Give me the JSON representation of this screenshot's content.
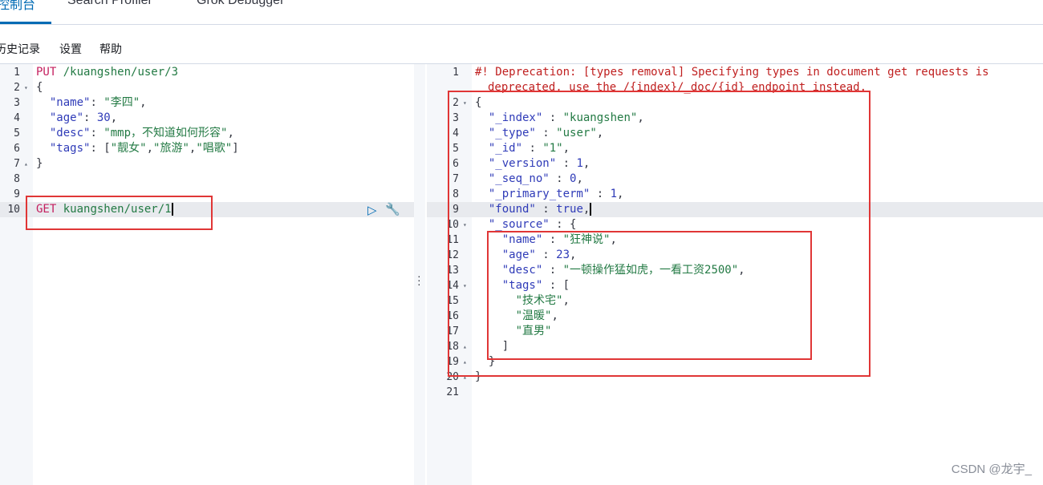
{
  "tabs": [
    {
      "label": "控制台",
      "active": true
    },
    {
      "label": "Search Profiler",
      "active": false
    },
    {
      "label": "Grok Debugger",
      "active": false
    }
  ],
  "menu": {
    "history": "历史记录",
    "settings": "设置",
    "help": "帮助"
  },
  "request": {
    "method1": "PUT",
    "url1": "/kuangshen/user/3",
    "name_key": "\"name\"",
    "name_val": "\"李四\"",
    "age_key": "\"age\"",
    "age_val": "30",
    "desc_key": "\"desc\"",
    "desc_val": "\"mmp，不知道如何形容\"",
    "tags_key": "\"tags\"",
    "tag1": "\"靓女\"",
    "tag2": "\"旅游\"",
    "tag3": "\"唱歌\"",
    "method2": "GET",
    "url2": "kuangshen/user/1"
  },
  "response": {
    "deprecation1": "#! Deprecation: [types removal] Specifying types in document get requests is",
    "deprecation2": "deprecated, use the /{index}/_doc/{id} endpoint instead.",
    "index_key": "\"_index\"",
    "index_val": "\"kuangshen\"",
    "type_key": "\"_type\"",
    "type_val": "\"user\"",
    "id_key": "\"_id\"",
    "id_val": "\"1\"",
    "version_key": "\"_version\"",
    "version_val": "1",
    "seq_key": "\"_seq_no\"",
    "seq_val": "0",
    "term_key": "\"_primary_term\"",
    "term_val": "1",
    "found_key": "\"found\"",
    "found_val": "true",
    "source_key": "\"_source\"",
    "name_key": "\"name\"",
    "name_val": "\"狂神说\"",
    "age_key": "\"age\"",
    "age_val": "23",
    "desc_key": "\"desc\"",
    "desc_val": "\"一顿操作猛如虎，一看工资2500\"",
    "tags_key": "\"tags\"",
    "tag1": "\"技术宅\"",
    "tag2": "\"温暖\"",
    "tag3": "\"直男\""
  },
  "line_numbers": [
    "1",
    "2",
    "3",
    "4",
    "5",
    "6",
    "7",
    "8",
    "9",
    "10",
    "11",
    "12",
    "13",
    "14",
    "15",
    "16",
    "17",
    "18",
    "19",
    "20",
    "21"
  ],
  "watermark": "CSDN @龙宇_",
  "colors": {
    "accent": "#006bb4",
    "highlight_box": "#e03636"
  }
}
